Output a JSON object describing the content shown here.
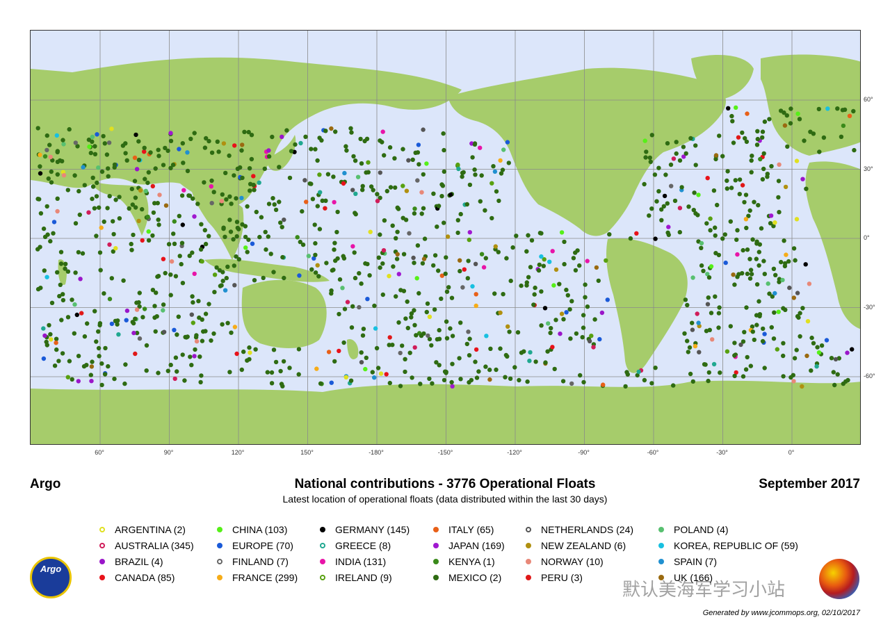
{
  "title_left": "Argo",
  "title_center": "National contributions -  3776 Operational Floats",
  "title_right": "September 2017",
  "subtitle": "Latest location of operational floats (data distributed within the last 30 days)",
  "generated_by": "Generated by www.jcommops.org, 02/10/2017",
  "watermark": "默认美海军学习小站",
  "logo_text": "Argo",
  "lon_ticks": [
    "60°",
    "90°",
    "120°",
    "150°",
    "-180°",
    "-150°",
    "-120°",
    "-90°",
    "-60°",
    "-30°",
    "0°"
  ],
  "lat_ticks": [
    "60°",
    "30°",
    "0°",
    "-30°",
    "-60°"
  ],
  "colors": {
    "ocean": "#dce6fa",
    "land": "#a6cc6b",
    "grid": "#8a8a8a",
    "float_default": "#2e6b12"
  },
  "legend": [
    {
      "label": "ARGENTINA (2)",
      "color": "#e0e020",
      "style": "ring"
    },
    {
      "label": "AUSTRALIA (345)",
      "color": "#d01c5a",
      "style": "ring"
    },
    {
      "label": "BRAZIL (4)",
      "color": "#9a16c9",
      "style": "fill"
    },
    {
      "label": "CANADA (85)",
      "color": "#e8121a",
      "style": "fill"
    },
    {
      "label": "CHINA (103)",
      "color": "#56f018",
      "style": "fill"
    },
    {
      "label": "EUROPE (70)",
      "color": "#1a5ad8",
      "style": "fill"
    },
    {
      "label": "FINLAND (7)",
      "color": "#666666",
      "style": "ring"
    },
    {
      "label": "FRANCE (299)",
      "color": "#f6ac18",
      "style": "fill"
    },
    {
      "label": "GERMANY (145)",
      "color": "#000000",
      "style": "fill"
    },
    {
      "label": "GREECE (8)",
      "color": "#20a890",
      "style": "ring"
    },
    {
      "label": "INDIA (131)",
      "color": "#e814a8",
      "style": "fill"
    },
    {
      "label": "IRELAND (9)",
      "color": "#58a010",
      "style": "ring"
    },
    {
      "label": "ITALY (65)",
      "color": "#e86018",
      "style": "fill"
    },
    {
      "label": "JAPAN (169)",
      "color": "#a018d0",
      "style": "fill"
    },
    {
      "label": "KENYA (1)",
      "color": "#3a8a1a",
      "style": "fill"
    },
    {
      "label": "MEXICO (2)",
      "color": "#2e6b12",
      "style": "fill"
    },
    {
      "label": "NETHERLANDS (24)",
      "color": "#555555",
      "style": "ring"
    },
    {
      "label": "NEW ZEALAND (6)",
      "color": "#b09010",
      "style": "fill"
    },
    {
      "label": "NORWAY (10)",
      "color": "#e88878",
      "style": "fill"
    },
    {
      "label": "PERU (3)",
      "color": "#e01818",
      "style": "fill"
    },
    {
      "label": "POLAND (4)",
      "color": "#58c070",
      "style": "fill"
    },
    {
      "label": "KOREA, REPUBLIC OF (59)",
      "color": "#18c0e0",
      "style": "fill"
    },
    {
      "label": "SPAIN (7)",
      "color": "#2090d0",
      "style": "fill"
    },
    {
      "label": "UK (166)",
      "color": "#9a6a10",
      "style": "fill"
    }
  ]
}
